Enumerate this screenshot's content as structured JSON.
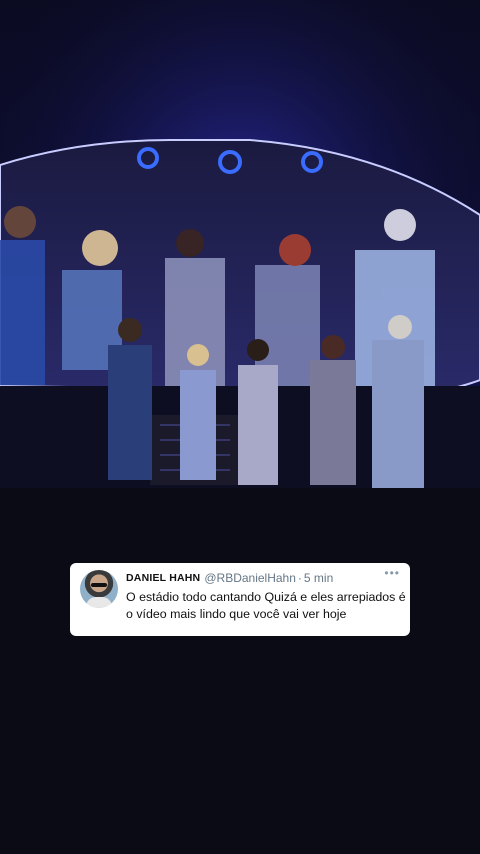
{
  "tweet": {
    "display_name": "DANIEL HAHN",
    "handle": "@RBDanielHahn",
    "separator": "·",
    "time": "5 min",
    "more_icon": "more-options-icon",
    "text": "O estádio todo cantando Quizá e eles arrepiados é o vídeo mais lindo que você vai ver hoje"
  },
  "colors": {
    "stage_blue": "#2233aa",
    "card_bg": "#ffffff",
    "secondary_text": "#657786"
  }
}
